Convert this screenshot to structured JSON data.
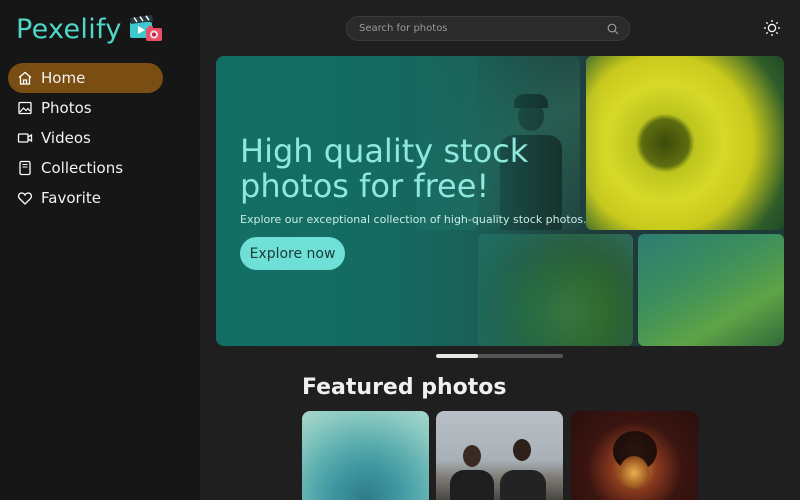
{
  "app": {
    "name": "Pexelify",
    "logo_icon": "clapperboard-camera-icon"
  },
  "sidebar": {
    "items": [
      {
        "label": "Home",
        "icon": "home-icon",
        "active": true
      },
      {
        "label": "Photos",
        "icon": "image-icon",
        "active": false
      },
      {
        "label": "Videos",
        "icon": "video-icon",
        "active": false
      },
      {
        "label": "Collections",
        "icon": "collections-icon",
        "active": false
      },
      {
        "label": "Favorite",
        "icon": "heart-icon",
        "active": false
      }
    ]
  },
  "header": {
    "search_placeholder": "Search for photos",
    "search_icon": "search-icon",
    "theme_icon": "sun-icon"
  },
  "hero": {
    "title": "High quality stock photos for free!",
    "subtitle": "Explore our exceptional collection of high-quality stock photos.",
    "button_label": "Explore now",
    "carousel_progress": 0.33
  },
  "featured": {
    "title": "Featured photos"
  },
  "colors": {
    "accent": "#4fd8c8",
    "active_nav": "#7a4d13",
    "hero_button": "#6fe0d6"
  }
}
